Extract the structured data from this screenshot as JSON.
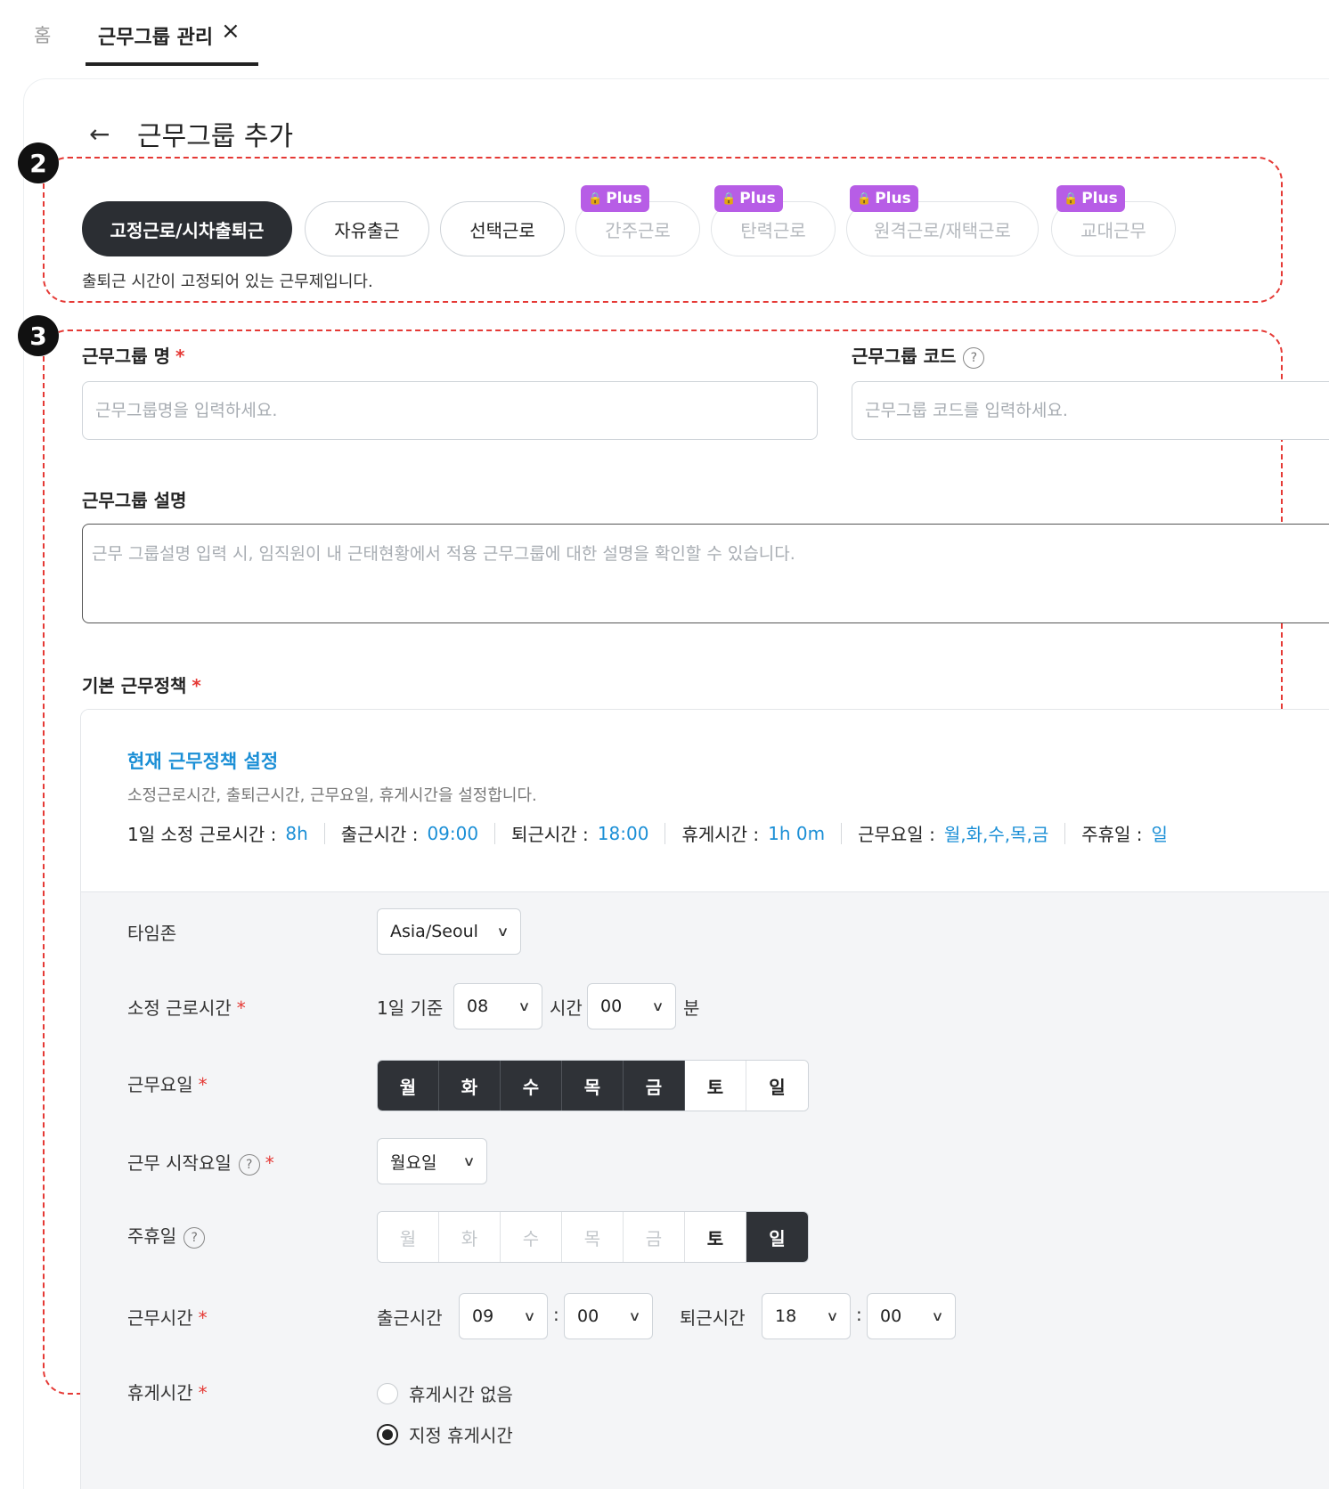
{
  "tabs": {
    "home": "홈",
    "active": "근무그룹 관리",
    "close_icon": "close-icon"
  },
  "header": {
    "back_icon": "arrow-left-icon",
    "title": "근무그룹 추가"
  },
  "annotations": {
    "box2": "2",
    "box3": "3",
    "color": "#e53935"
  },
  "work_types": {
    "chips": [
      "고정근로/시차출퇴근",
      "자유출근",
      "선택근로",
      "간주근로",
      "탄력근로",
      "원격근로/재택근로",
      "교대근무"
    ],
    "plus_label": "Plus",
    "plus_color": "#b75de6",
    "description": "출퇴근 시간이 고정되어 있는 근무제입니다."
  },
  "form": {
    "name_label": "근무그룹 명",
    "name_placeholder": "근무그룹명을 입력하세요.",
    "code_label": "근무그룹 코드",
    "code_placeholder": "근무그룹 코드를 입력하세요.",
    "desc_label": "근무그룹 설명",
    "desc_placeholder": "근무 그룹설명 입력 시, 임직원이 내 근태현황에서 적용 근무그룹에 대한 설명을 확인할 수 있습니다.",
    "policy_label": "기본 근무정책",
    "required_mark": "*"
  },
  "policy": {
    "title": "현재 근무정책 설정",
    "description": "소정근로시간, 출퇴근시간, 근무요일, 휴게시간을 설정합니다.",
    "summary": [
      {
        "key": "1일 소정 근로시간 :",
        "value": "8h"
      },
      {
        "key": "출근시간 :",
        "value": "09:00"
      },
      {
        "key": "퇴근시간 :",
        "value": "18:00"
      },
      {
        "key": "휴게시간 :",
        "value": "1h 0m"
      },
      {
        "key": "근무요일 :",
        "value": "월,화,수,목,금"
      },
      {
        "key": "주휴일 :",
        "value": "일"
      }
    ],
    "accent_color": "#1b8fd6",
    "timezone_label": "타임존",
    "timezone_value": "Asia/Seoul",
    "hours_label": "소정 근로시간",
    "hours_prefix": "1일 기준",
    "hours_value": "08",
    "hours_unit": "시간",
    "minutes_value": "00",
    "minutes_unit": "분",
    "workdays_label": "근무요일",
    "days": [
      "월",
      "화",
      "수",
      "목",
      "금",
      "토",
      "일"
    ],
    "startday_label": "근무 시작요일",
    "startday_value": "월요일",
    "weekly_holiday_label": "주휴일",
    "worktime_label": "근무시간",
    "in_label": "출근시간",
    "in_hour": "09",
    "in_min": "00",
    "out_label": "퇴근시간",
    "out_hour": "18",
    "out_min": "00",
    "colon": ":",
    "break_label": "휴게시간",
    "break_none": "휴게시간 없음",
    "break_fixed": "지정 휴게시간"
  }
}
